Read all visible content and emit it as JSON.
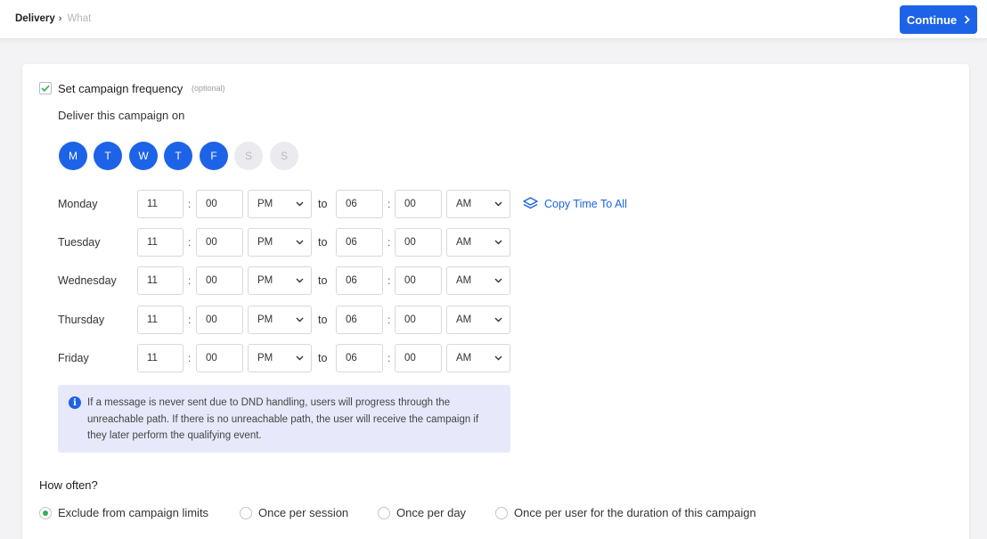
{
  "header": {
    "breadcrumb_active": "Delivery",
    "breadcrumb_separator": "›",
    "breadcrumb_next": "What",
    "continue_label": "Continue",
    "continue_icon": "chevron-right-icon",
    "accent_color": "#1d63e8"
  },
  "frequency": {
    "checkbox_checked": true,
    "label": "Set campaign frequency",
    "optional_tag": "(optional)",
    "deliver_label": "Deliver this campaign on"
  },
  "days": [
    {
      "letter": "M",
      "selected": true
    },
    {
      "letter": "T",
      "selected": true
    },
    {
      "letter": "W",
      "selected": true
    },
    {
      "letter": "T",
      "selected": true
    },
    {
      "letter": "F",
      "selected": true
    },
    {
      "letter": "S",
      "selected": false
    },
    {
      "letter": "S",
      "selected": false
    }
  ],
  "schedule": {
    "to_label": "to",
    "colon": ":",
    "copy_label": "Copy Time To All",
    "copy_icon": "layers-icon",
    "rows": [
      {
        "day": "Monday",
        "from_hour": "11",
        "from_minute": "00",
        "from_period": "PM",
        "to_hour": "06",
        "to_minute": "00",
        "to_period": "AM"
      },
      {
        "day": "Tuesday",
        "from_hour": "11",
        "from_minute": "00",
        "from_period": "PM",
        "to_hour": "06",
        "to_minute": "00",
        "to_period": "AM"
      },
      {
        "day": "Wednesday",
        "from_hour": "11",
        "from_minute": "00",
        "from_period": "PM",
        "to_hour": "06",
        "to_minute": "00",
        "to_period": "AM"
      },
      {
        "day": "Thursday",
        "from_hour": "11",
        "from_minute": "00",
        "from_period": "PM",
        "to_hour": "06",
        "to_minute": "00",
        "to_period": "AM"
      },
      {
        "day": "Friday",
        "from_hour": "11",
        "from_minute": "00",
        "from_period": "PM",
        "to_hour": "06",
        "to_minute": "00",
        "to_period": "AM"
      }
    ]
  },
  "info": {
    "icon": "info-icon",
    "text": "If a message is never sent due to DND handling, users will progress through the unreachable path. If there is no unreachable path, the user will receive the campaign if they later perform the qualifying event."
  },
  "how_often": {
    "title": "How often?",
    "options": [
      {
        "label": "Exclude from campaign limits",
        "selected": true
      },
      {
        "label": "Once per session",
        "selected": false
      },
      {
        "label": "Once per day",
        "selected": false
      },
      {
        "label": "Once per user for the duration of this campaign",
        "selected": false
      }
    ],
    "selected_color": "#34b15a"
  }
}
